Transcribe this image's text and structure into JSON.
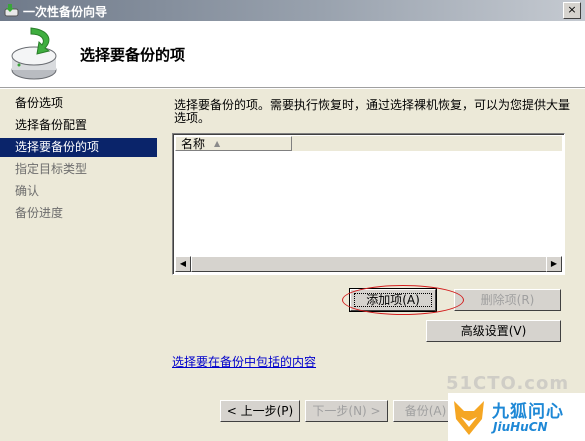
{
  "window": {
    "title": "一次性备份向导",
    "close_label": "×"
  },
  "header": {
    "title": "选择要备份的项"
  },
  "sidebar": {
    "steps": [
      {
        "label": "备份选项"
      },
      {
        "label": "选择备份配置"
      },
      {
        "label": "选择要备份的项"
      },
      {
        "label": "指定目标类型"
      },
      {
        "label": "确认"
      },
      {
        "label": "备份进度"
      }
    ]
  },
  "main": {
    "description": "选择要备份的项。需要执行恢复时，通过选择裸机恢复，可以为您提供大量选项。",
    "list": {
      "columns": [
        "名称"
      ],
      "rows": []
    },
    "add_item_label": "添加项(A)",
    "remove_item_label": "删除项(R)",
    "advanced_label": "高级设置(V)",
    "link_text": "选择要在备份中包括的内容"
  },
  "footer": {
    "prev_label": "< 上一步(P)",
    "next_label": "下一步(N) >",
    "backup_label": "备份(A)"
  },
  "watermark": "51CTO.com",
  "brand": {
    "name_cn": "九狐问心",
    "name_en": "JiuHuCN"
  },
  "colors": {
    "selection": "#0a246a",
    "dialog_bg": "#ece9d8",
    "link": "#0000cc",
    "annotation": "#d21e1e",
    "brand": "#1e88d6"
  }
}
